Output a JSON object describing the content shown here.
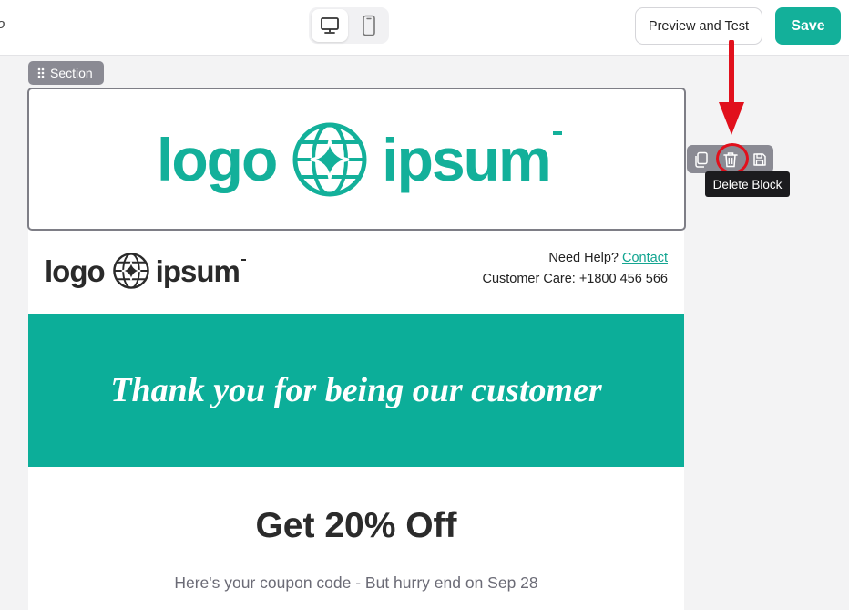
{
  "topbar": {
    "cut_text": "o",
    "preview_label": "Preview and Test",
    "save_label": "Save",
    "device_toggle": [
      "desktop-icon",
      "mobile-icon"
    ]
  },
  "editor": {
    "section_label": "Section",
    "tooltip": "Delete Block",
    "toolbar_icons": [
      "copy-icon",
      "trash-icon",
      "save-icon"
    ]
  },
  "email": {
    "logo_text_left": "logo",
    "logo_text_right": "ipsum",
    "help_prefix": "Need Help?",
    "help_link": "Contact",
    "customer_care": "Customer Care: +1800 456 566",
    "banner_text": "Thank you for being our customer",
    "offer_title": "Get 20% Off",
    "coupon_text": "Here's your coupon code - But hurry end on Sep 28"
  },
  "colors": {
    "brand": "#13b09a",
    "banner": "#0cae99",
    "annotation": "#e1101c"
  }
}
